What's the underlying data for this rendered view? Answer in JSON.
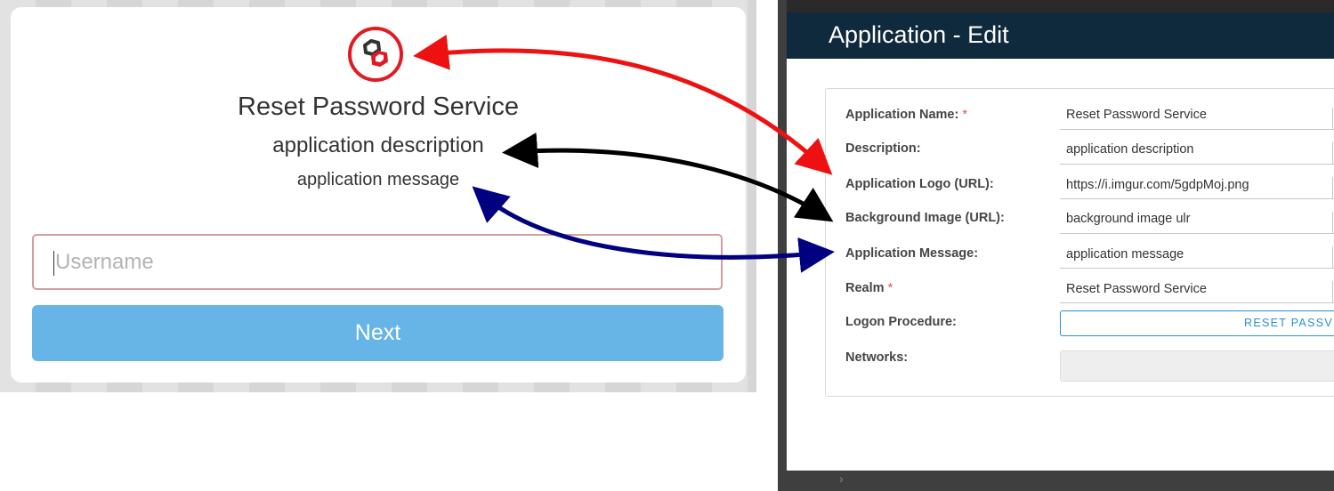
{
  "login": {
    "title": "Reset Password Service",
    "description": "application description",
    "message": "application message",
    "username_placeholder": "Username",
    "next_label": "Next"
  },
  "admin": {
    "modal_title": "Application - Edit",
    "fields": [
      {
        "label": "Application Name:",
        "required": true,
        "value": "Reset Password Service"
      },
      {
        "label": "Description:",
        "required": false,
        "value": "application description"
      },
      {
        "label": "Application Logo (URL):",
        "required": false,
        "value": "https://i.imgur.com/5gdpMoj.png"
      },
      {
        "label": "Background Image (URL):",
        "required": false,
        "value": "background image ulr"
      },
      {
        "label": "Application Message:",
        "required": false,
        "value": "application message"
      },
      {
        "label": "Realm",
        "required": true,
        "value": "Reset Password Service"
      },
      {
        "label": "Logon Procedure:",
        "required": false,
        "value": ""
      },
      {
        "label": "Networks:",
        "required": false,
        "value": ""
      }
    ],
    "required_marker": "*",
    "logon_procedure_button": "RESET PASSV"
  },
  "colors": {
    "logo_red": "#e11b22",
    "arrow_red": "#ee1111",
    "arrow_black": "#000000",
    "arrow_navy": "#000080",
    "next_button": "#66b5e6",
    "header_navy": "#0f2a3d",
    "accent_blue": "#2b8fd0"
  },
  "icons": {
    "logo": "chained-hexagons-logo",
    "chevron": "chevron-right-icon"
  }
}
